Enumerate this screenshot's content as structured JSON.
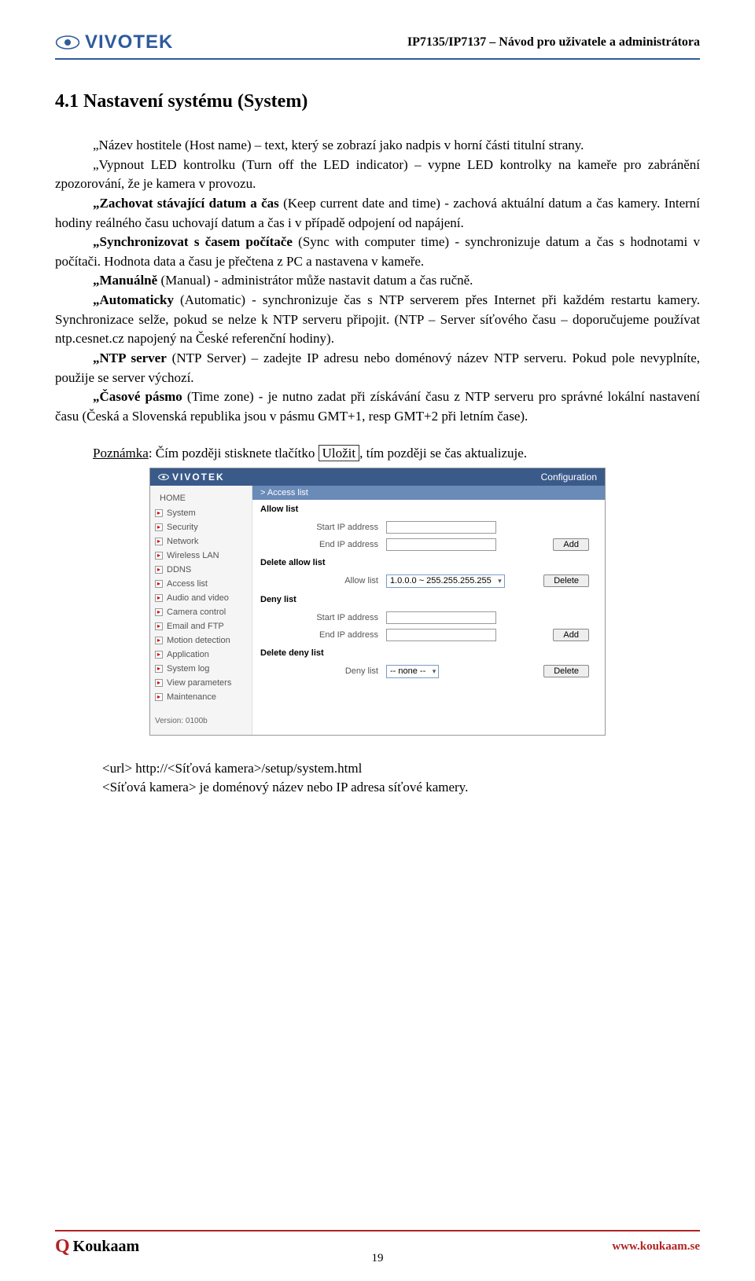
{
  "header": {
    "logo_text": "VIVOTEK",
    "doc_title": "IP7135/IP7137 – Návod pro uživatele a administrátora"
  },
  "section_title": "4.1  Nastavení systému (System)",
  "paragraphs": {
    "p1": "„Název hostitele (Host name) – text, který se zobrazí jako nadpis v horní části titulní strany.",
    "p2": "„Vypnout LED kontrolku (Turn off the LED indicator) – vypne LED kontrolky na kameře pro zabránění zpozorování, že je kamera v provozu.",
    "p3_a": "„Zachovat stávající datum a čas",
    "p3_b": " (Keep current date and time) - zachová aktuální datum a čas kamery. Interní hodiny reálného času uchovají datum a čas i v případě odpojení od napájení.",
    "p4_a": "„Synchronizovat s časem počítače",
    "p4_b": " (Sync with computer time) - synchronizuje datum a čas s hodnotami v počítači. Hodnota data a času je přečtena z PC a nastavena v kameře.",
    "p5_a": "„Manuálně",
    "p5_b": " (Manual) - administrátor může nastavit datum a čas ručně.",
    "p6_a": "„Automaticky",
    "p6_b": " (Automatic) - synchronizuje čas s NTP serverem přes Internet při každém restartu kamery. Synchronizace selže, pokud se nelze k NTP serveru připojit. (NTP – Server síťového času – doporučujeme používat ntp.cesnet.cz napojený na České referenční hodiny).",
    "p7_a": "„NTP server",
    "p7_b": " (NTP Server) – zadejte IP adresu nebo doménový název NTP serveru. Pokud pole nevyplníte, použije se server výchozí.",
    "p8_a": "„Časové pásmo",
    "p8_b": " (Time zone) - je nutno zadat při získávání času z NTP serveru pro správné lokální nastavení času (Česká a Slovenská republika  jsou v pásmu GMT+1, resp GMT+2 při letním čase)."
  },
  "note": {
    "label": "Poznámka",
    "pre": ": Čím později stisknete tlačítko ",
    "button": "Uložit",
    "post": ", tím později  se čas aktualizuje."
  },
  "screenshot": {
    "config_label": "Configuration",
    "logo": "VIVOTEK",
    "breadcrumb": "> Access list",
    "home": "HOME",
    "nav": [
      "System",
      "Security",
      "Network",
      "Wireless LAN",
      "DDNS",
      "Access list",
      "Audio and video",
      "Camera control",
      "Email and FTP",
      "Motion detection",
      "Application",
      "System log",
      "View parameters",
      "Maintenance"
    ],
    "version": "Version: 0100b",
    "allow_list": "Allow list",
    "start_ip": "Start IP address",
    "end_ip": "End IP address",
    "add_btn": "Add",
    "delete_allow": "Delete allow list",
    "allow_list_label": "Allow list",
    "allow_select": "1.0.0.0 ~ 255.255.255.255",
    "delete_btn": "Delete",
    "deny_list": "Deny list",
    "delete_deny": "Delete deny list",
    "deny_list_label": "Deny list",
    "deny_select": "-- none --"
  },
  "url_lines": {
    "l1": "<url> http://<Síťová kamera>/setup/system.html",
    "l2": "<Síťová kamera> je doménový název nebo IP adresa síťové kamery."
  },
  "footer": {
    "logo": "Koukaam",
    "url": "www.koukaam.se",
    "page": "19"
  }
}
